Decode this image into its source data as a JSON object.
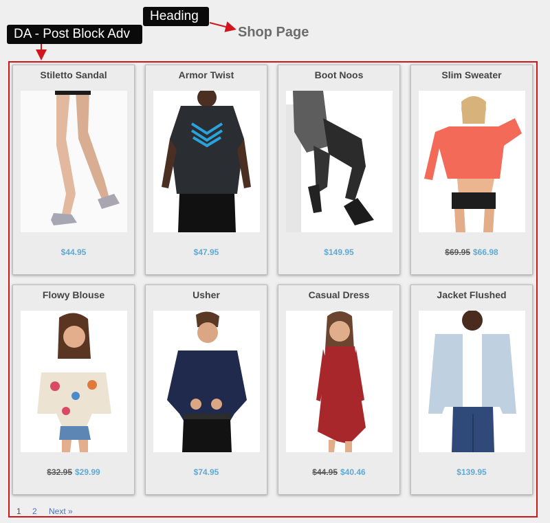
{
  "annotations": {
    "heading_label": "Heading",
    "block_label": "DA - Post Block Adv"
  },
  "page_title": "Shop Page",
  "colors": {
    "annotation_red": "#d0161c",
    "price_blue": "#5fa9d3",
    "card_bg": "#ececec",
    "page_bg": "#efefef"
  },
  "products": [
    {
      "name": "Stiletto Sandal",
      "old_price": "",
      "price": "$44.95",
      "image": "legs-heels-photo"
    },
    {
      "name": "Armor Twist",
      "old_price": "",
      "price": "$47.95",
      "image": "man-compression-shirt-photo"
    },
    {
      "name": "Boot Noos",
      "old_price": "",
      "price": "$149.95",
      "image": "seated-man-boots-photo"
    },
    {
      "name": "Slim Sweater",
      "old_price": "$69.95",
      "price": "$66.98",
      "image": "woman-coral-sweater-photo"
    },
    {
      "name": "Flowy Blouse",
      "old_price": "$32.95",
      "price": "$29.99",
      "image": "woman-floral-blouse-photo"
    },
    {
      "name": "Usher",
      "old_price": "",
      "price": "$74.95",
      "image": "man-navy-shirt-photo"
    },
    {
      "name": "Casual Dress",
      "old_price": "$44.95",
      "price": "$40.46",
      "image": "woman-red-dress-photo"
    },
    {
      "name": "Jacket Flushed",
      "old_price": "",
      "price": "$139.95",
      "image": "man-denim-jacket-photo"
    }
  ],
  "pagination": {
    "page1": "1",
    "page2": "2",
    "next": "Next »"
  }
}
